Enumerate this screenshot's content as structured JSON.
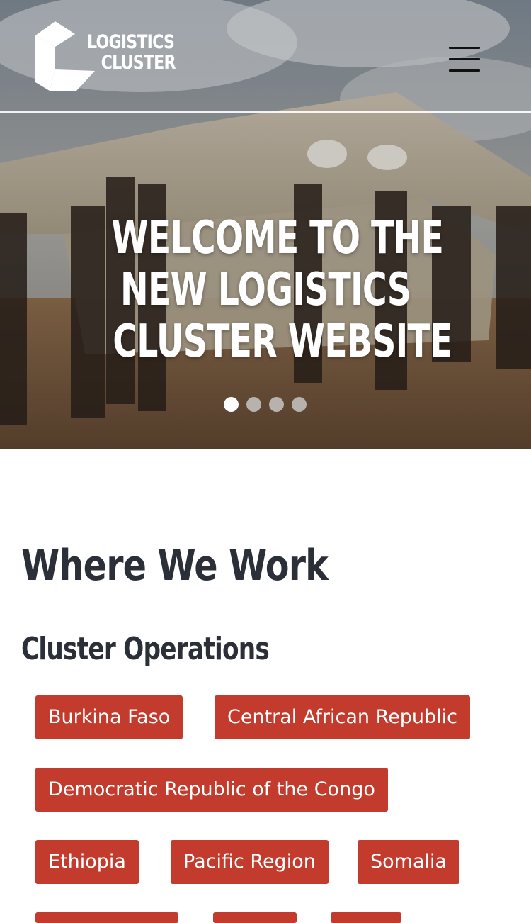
{
  "header": {
    "logo_line1": "LOGISTICS",
    "logo_line2": "CLUSTER",
    "menu_icon": "hamburger-menu-icon"
  },
  "hero": {
    "title_line1": "WELCOME TO THE",
    "title_line2": "NEW LOGISTICS",
    "title_line3": "CLUSTER WEBSITE",
    "slide_count": 4,
    "active_slide": 1
  },
  "main": {
    "heading": "Where We Work",
    "subheading": "Cluster Operations",
    "operations": [
      "Burkina Faso",
      "Central African Republic",
      "Democratic Republic of the Congo",
      "Ethiopia",
      "Pacific Region",
      "Somalia"
    ]
  },
  "colors": {
    "accent": "#c23b2c",
    "heading_text": "#2b2f38",
    "hero_text": "#ffffff"
  }
}
